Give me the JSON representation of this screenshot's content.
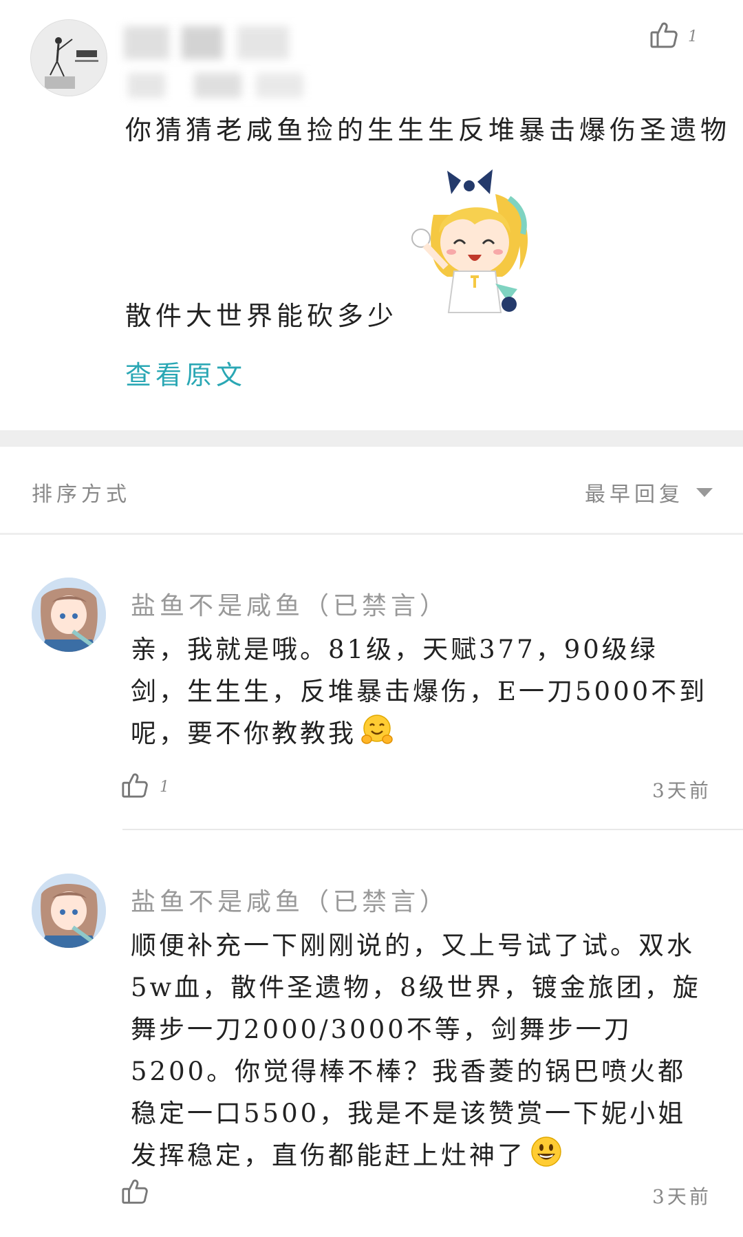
{
  "post": {
    "like_count": "1",
    "text_line_1": "你猜猜老咸鱼捡的生生生反堆暴击爆伤圣遗物",
    "text_line_2": "散件大世界能砍多少",
    "view_original": "查看原文"
  },
  "sort": {
    "label": "排序方式",
    "value": "最早回复"
  },
  "comments": [
    {
      "name": "盐鱼不是咸鱼（已禁言）",
      "body": "亲，我就是哦。81级，天赋377，90级绿剑，生生生，反堆暴击爆伤，E一刀5000不到呢，要不你教教我",
      "emoji": "hugging-face",
      "like_count": "1",
      "time": "3天前"
    },
    {
      "name": "盐鱼不是咸鱼（已禁言）",
      "body": "顺便补充一下刚刚说的，又上号试了试。双水5w血，散件圣遗物，8级世界，镀金旅团，旋舞步一刀2000/3000不等，剑舞步一刀5200。你觉得棒不棒？我香菱的锅巴喷火都稳定一口5500，我是不是该赞赏一下妮小姐发挥稳定，直伤都能赶上灶神了",
      "emoji": "grinning-face",
      "like_count": "",
      "time": "3天前"
    }
  ],
  "colors": {
    "accent_link": "#2aa7b4",
    "muted_text": "#888888",
    "separator": "#eeeeee"
  }
}
